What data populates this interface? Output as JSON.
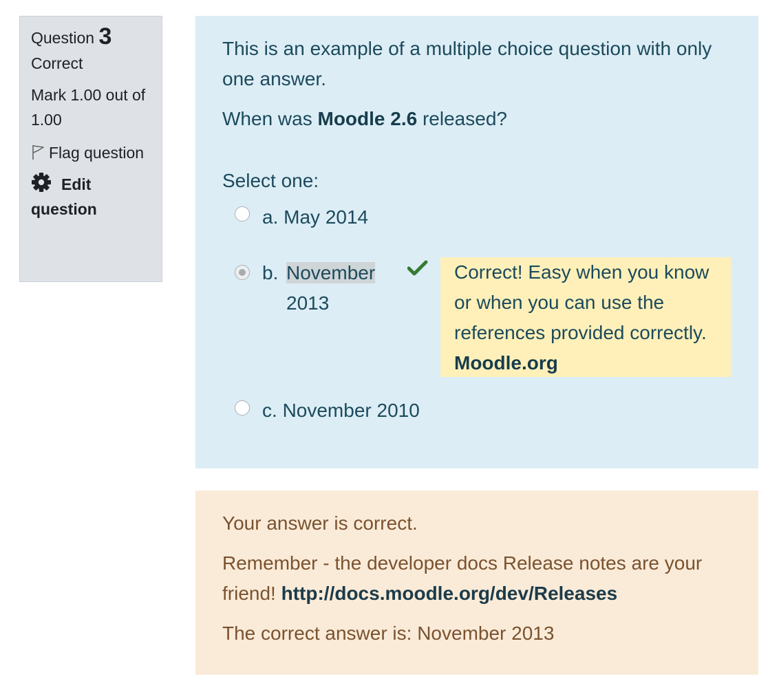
{
  "info": {
    "question_label": "Question",
    "question_number": "3",
    "state": "Correct",
    "grade": "Mark 1.00 out of 1.00",
    "flag_label": "Flag question",
    "edit_label": "Edit question"
  },
  "question": {
    "text_line1": "This is an example of a multiple choice question with only one answer.",
    "text_prefix": "When was ",
    "text_bold": "Moodle 2.6",
    "text_suffix": " released?",
    "prompt": "Select one:",
    "options": [
      {
        "letter": "a.",
        "text": "May 2014",
        "checked": false
      },
      {
        "letter": "b.",
        "text_part1": "November",
        "text_part2": "2013",
        "checked": true
      },
      {
        "letter": "c.",
        "text": "November 2010",
        "checked": false
      }
    ],
    "specific_feedback_text": "Correct! Easy when you know or when you can use the references provided correctly. ",
    "specific_feedback_link": "Moodle.org"
  },
  "outcome": {
    "result": "Your answer is correct.",
    "general_feedback_text": "Remember - the developer docs Release notes are your friend! ",
    "general_feedback_link": "http://docs.moodle.org/dev/Releases",
    "right_answer": "The correct answer is: November 2013"
  },
  "colors": {
    "info_bg": "#dee2e6",
    "formulation_bg": "#dcedf5",
    "feedback_bg": "#fff0b9",
    "outcome_bg": "#faebd8",
    "correct_check": "#357a32"
  },
  "icons": {
    "flag": "flag-outline-icon",
    "edit": "gear-icon",
    "correct": "checkmark-icon"
  }
}
